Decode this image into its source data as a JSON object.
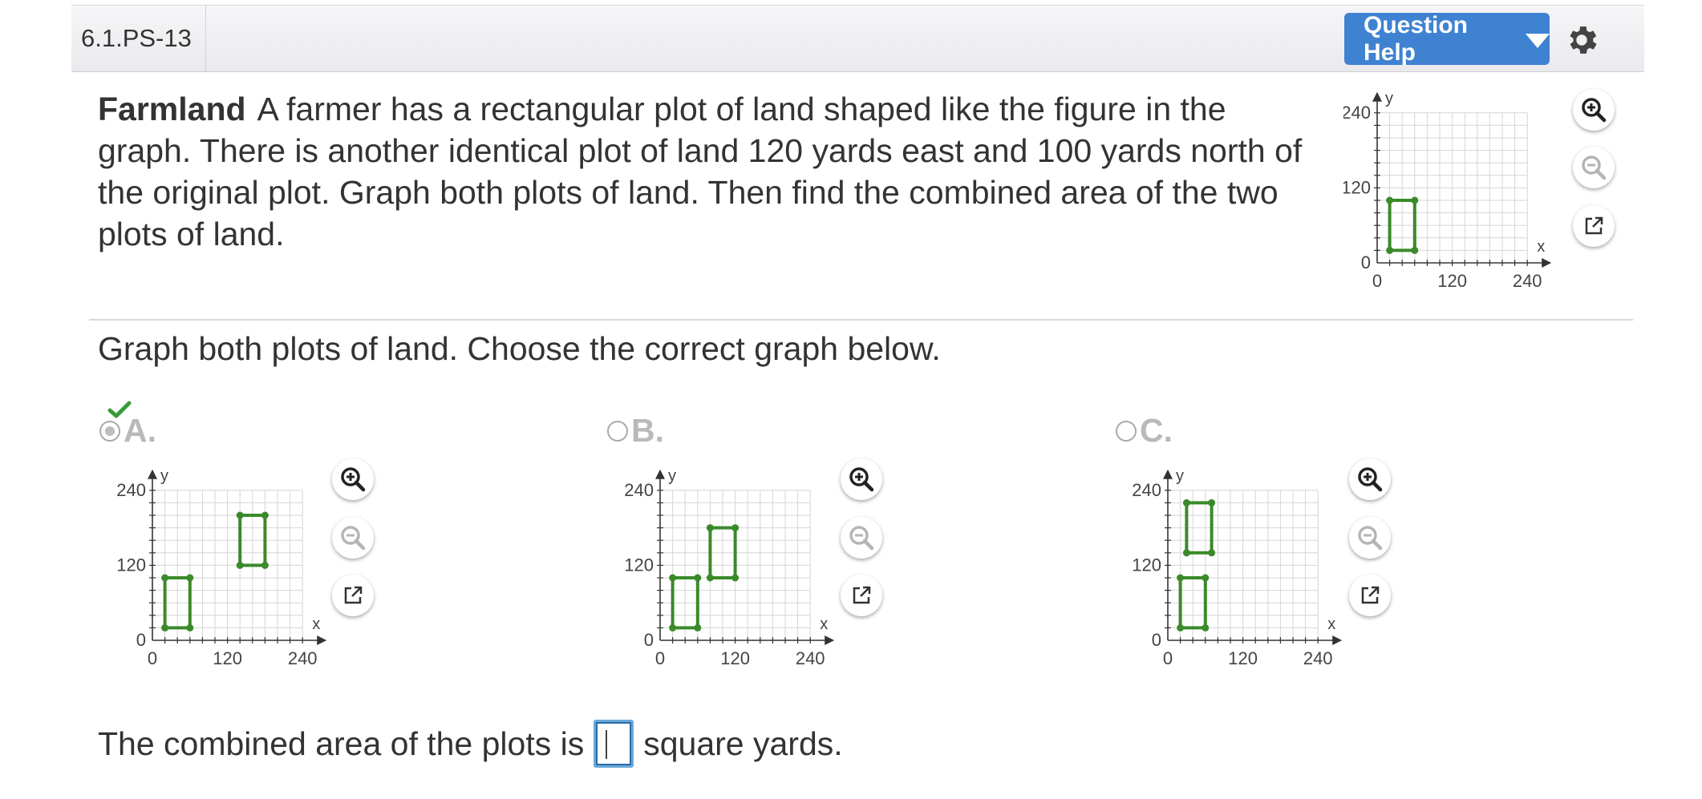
{
  "header": {
    "question_id": "6.1.PS-13",
    "help_label": "Question Help"
  },
  "prompt": {
    "title": "Farmland",
    "text": "A farmer has a rectangular plot of land shaped like the figure in the graph. There is another identical plot of land 120 yards east and 100 yards north of the original plot. Graph both plots of land. Then find the combined area of the two plots of land."
  },
  "instruction": "Graph both plots of land. Choose the correct graph below.",
  "choices": [
    {
      "letter": "A.",
      "selected": true
    },
    {
      "letter": "B.",
      "selected": false
    },
    {
      "letter": "C.",
      "selected": false
    }
  ],
  "answer": {
    "before": "The combined area of the plots is",
    "value": "",
    "after": "square yards."
  },
  "chart_data": [
    {
      "id": "prompt-graph",
      "type": "rectangle-plot",
      "xlabel": "x",
      "ylabel": "y",
      "xlim": [
        0,
        240
      ],
      "ylim": [
        0,
        240
      ],
      "ticks": [
        "0",
        "120",
        "240"
      ],
      "grid": true,
      "rects": [
        {
          "x": [
            20,
            60
          ],
          "y": [
            20,
            100
          ]
        }
      ]
    },
    {
      "id": "choice-a-graph",
      "type": "rectangle-plot",
      "xlabel": "x",
      "ylabel": "y",
      "xlim": [
        0,
        240
      ],
      "ylim": [
        0,
        240
      ],
      "ticks": [
        "0",
        "120",
        "240"
      ],
      "grid": true,
      "rects": [
        {
          "x": [
            20,
            60
          ],
          "y": [
            20,
            100
          ]
        },
        {
          "x": [
            140,
            180
          ],
          "y": [
            120,
            200
          ]
        }
      ]
    },
    {
      "id": "choice-b-graph",
      "type": "rectangle-plot",
      "xlabel": "x",
      "ylabel": "y",
      "xlim": [
        0,
        240
      ],
      "ylim": [
        0,
        240
      ],
      "ticks": [
        "0",
        "120",
        "240"
      ],
      "grid": true,
      "rects": [
        {
          "x": [
            20,
            60
          ],
          "y": [
            20,
            100
          ]
        },
        {
          "x": [
            80,
            120
          ],
          "y": [
            100,
            180
          ]
        }
      ]
    },
    {
      "id": "choice-c-graph",
      "type": "rectangle-plot",
      "xlabel": "x",
      "ylabel": "y",
      "xlim": [
        0,
        240
      ],
      "ylim": [
        0,
        240
      ],
      "ticks": [
        "0",
        "120",
        "240"
      ],
      "grid": true,
      "rects": [
        {
          "x": [
            20,
            60
          ],
          "y": [
            20,
            100
          ]
        },
        {
          "x": [
            30,
            70
          ],
          "y": [
            140,
            220
          ]
        }
      ]
    }
  ],
  "colors": {
    "accent": "#3f82d1",
    "plot_green": "#3a8a2a",
    "grid": "#d6d6d6",
    "check_green": "#3a9a3a"
  },
  "icons": {
    "zoom_in": "zoom-in-icon",
    "zoom_out": "zoom-out-icon",
    "popout": "popout-icon",
    "gear": "gear-icon",
    "check": "check-icon"
  }
}
